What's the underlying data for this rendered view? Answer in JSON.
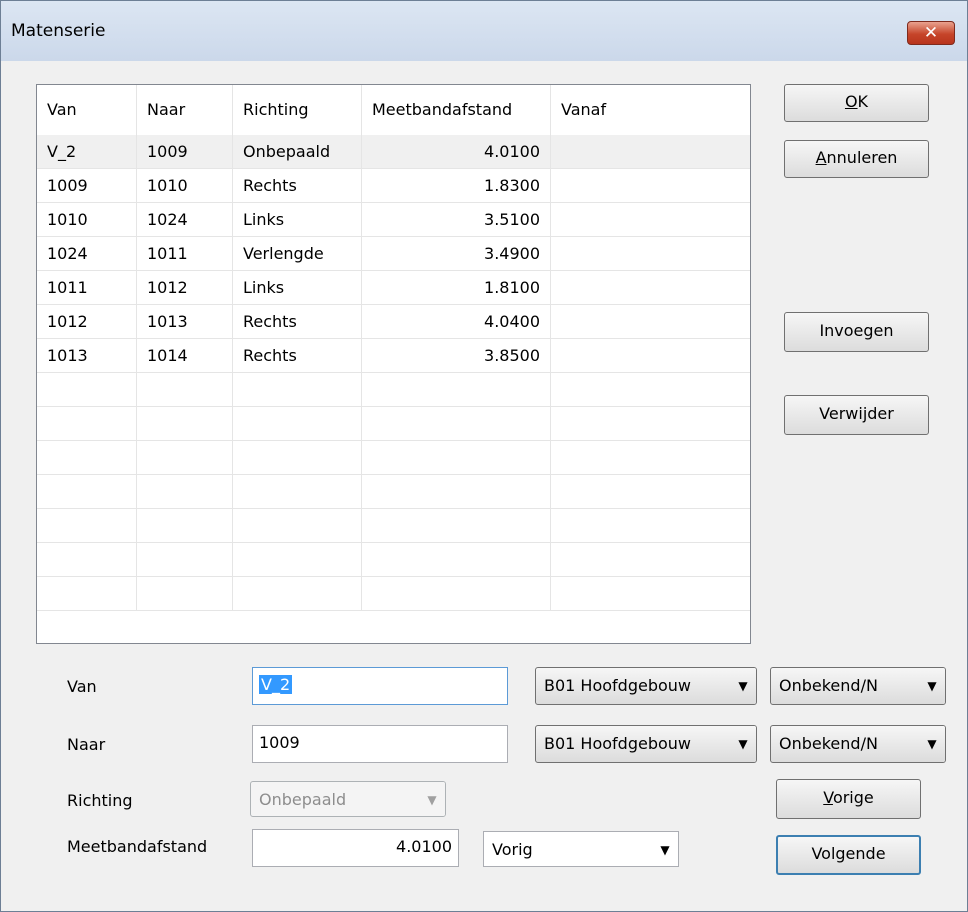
{
  "window": {
    "title": "Matenserie",
    "close_symbol": "✕"
  },
  "grid": {
    "columns": [
      "Van",
      "Naar",
      "Richting",
      "Meetbandafstand",
      "Vanaf"
    ],
    "rows": [
      {
        "van": "V_2",
        "naar": "1009",
        "richting": "Onbepaald",
        "afstand": "4.0100",
        "vanaf": ""
      },
      {
        "van": "1009",
        "naar": "1010",
        "richting": "Rechts",
        "afstand": "1.8300",
        "vanaf": ""
      },
      {
        "van": "1010",
        "naar": "1024",
        "richting": "Links",
        "afstand": "3.5100",
        "vanaf": ""
      },
      {
        "van": "1024",
        "naar": "1011",
        "richting": "Verlengde",
        "afstand": "3.4900",
        "vanaf": ""
      },
      {
        "van": "1011",
        "naar": "1012",
        "richting": "Links",
        "afstand": "1.8100",
        "vanaf": ""
      },
      {
        "van": "1012",
        "naar": "1013",
        "richting": "Rechts",
        "afstand": "4.0400",
        "vanaf": ""
      },
      {
        "van": "1013",
        "naar": "1014",
        "richting": "Rechts",
        "afstand": "3.8500",
        "vanaf": ""
      }
    ],
    "selected_row": 0
  },
  "buttons": {
    "ok_mnemonic": "O",
    "ok_rest": "K",
    "annuleren_mnemonic": "A",
    "annuleren_rest": "nnuleren",
    "invoegen": "Invoegen",
    "verwijder": "Verwijder",
    "vorige_mnemonic": "V",
    "vorige_rest": "orige",
    "volgende": "Volgende"
  },
  "form": {
    "van_label": "Van",
    "van_value": "V_2",
    "van_building": "B01 Hoofdgebouw",
    "van_status": "Onbekend/N",
    "naar_label": "Naar",
    "naar_value": "1009",
    "naar_building": "B01 Hoofdgebouw",
    "naar_status": "Onbekend/N",
    "richting_label": "Richting",
    "richting_value": "Onbepaald",
    "meetband_label": "Meetbandafstand",
    "meetband_value": "4.0100",
    "meetband_mode": "Vorig"
  },
  "icons": {
    "dropdown": "▼",
    "dropdown_disabled": "▼"
  },
  "colors": {
    "selection": "#3399ff",
    "close_button": "#c6452a",
    "titlebar": "#cbd8ea"
  }
}
